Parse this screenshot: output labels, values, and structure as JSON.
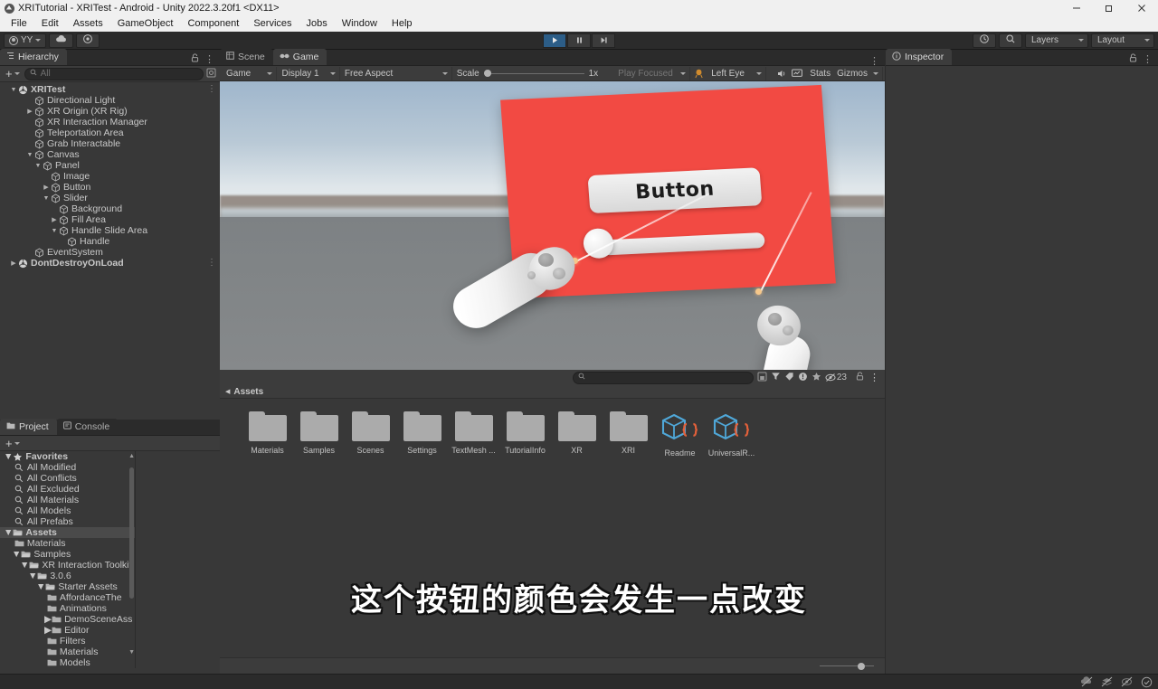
{
  "window": {
    "title": "XRITutorial - XRITest - Android - Unity 2022.3.20f1 <DX11>",
    "app_icon": "unity-logo-icon",
    "minimize": "minimize-icon",
    "restore": "restore-icon",
    "close": "close-icon"
  },
  "menubar": {
    "items": [
      "File",
      "Edit",
      "Assets",
      "GameObject",
      "Component",
      "Services",
      "Jobs",
      "Window",
      "Help"
    ]
  },
  "toolbar": {
    "account_label": "YY",
    "account_icon": "account-icon",
    "cloud_icon": "cloud-icon",
    "settings_icon": "gear-icon",
    "play_icon": "play-icon",
    "pause_icon": "pause-icon",
    "step_icon": "step-icon",
    "play_active": true,
    "history_icon": "undo-history-icon",
    "search_icon": "search-icon",
    "layers_label": "Layers",
    "layout_label": "Layout"
  },
  "hierarchy": {
    "tab_label": "Hierarchy",
    "tab_icon": "hierarchy-icon",
    "lock_icon": "lock-icon",
    "menu_icon": "kebab-icon",
    "add_label": "+",
    "search_placeholder": "All",
    "search_icon": "search-icon",
    "filter_icon": "filter-icon",
    "items": [
      {
        "label": "XRITest",
        "depth": 0,
        "twist": "down",
        "icon": "scene-icon",
        "kebab": true
      },
      {
        "label": "Directional Light",
        "depth": 2,
        "twist": "",
        "icon": "gameobject-icon",
        "kebab": false
      },
      {
        "label": "XR Origin (XR Rig)",
        "depth": 2,
        "twist": "right",
        "icon": "gameobject-icon",
        "kebab": false
      },
      {
        "label": "XR Interaction Manager",
        "depth": 2,
        "twist": "",
        "icon": "gameobject-icon",
        "kebab": false
      },
      {
        "label": "Teleportation Area",
        "depth": 2,
        "twist": "",
        "icon": "gameobject-icon",
        "kebab": false
      },
      {
        "label": "Grab Interactable",
        "depth": 2,
        "twist": "",
        "icon": "gameobject-icon",
        "kebab": false
      },
      {
        "label": "Canvas",
        "depth": 2,
        "twist": "down",
        "icon": "gameobject-icon",
        "kebab": false
      },
      {
        "label": "Panel",
        "depth": 3,
        "twist": "down",
        "icon": "gameobject-icon",
        "kebab": false
      },
      {
        "label": "Image",
        "depth": 4,
        "twist": "",
        "icon": "gameobject-icon",
        "kebab": false
      },
      {
        "label": "Button",
        "depth": 4,
        "twist": "right",
        "icon": "gameobject-icon",
        "kebab": false
      },
      {
        "label": "Slider",
        "depth": 4,
        "twist": "down",
        "icon": "gameobject-icon",
        "kebab": false
      },
      {
        "label": "Background",
        "depth": 5,
        "twist": "",
        "icon": "gameobject-icon",
        "kebab": false
      },
      {
        "label": "Fill Area",
        "depth": 5,
        "twist": "right",
        "icon": "gameobject-icon",
        "kebab": false
      },
      {
        "label": "Handle Slide Area",
        "depth": 5,
        "twist": "down",
        "icon": "gameobject-icon",
        "kebab": false
      },
      {
        "label": "Handle",
        "depth": 6,
        "twist": "",
        "icon": "gameobject-icon",
        "kebab": false
      },
      {
        "label": "EventSystem",
        "depth": 2,
        "twist": "",
        "icon": "gameobject-icon",
        "kebab": false
      },
      {
        "label": "DontDestroyOnLoad",
        "depth": 0,
        "twist": "right",
        "icon": "scene-icon",
        "kebab": true
      }
    ]
  },
  "gameview": {
    "tabs": [
      {
        "label": "Scene",
        "icon": "scene-tab-icon",
        "active": false
      },
      {
        "label": "Game",
        "icon": "game-tab-icon",
        "active": true
      }
    ],
    "menu_icon": "kebab-icon",
    "display_mode": "Game",
    "display": "Display 1",
    "aspect": "Free Aspect",
    "scale_label": "Scale",
    "scale_value": "1x",
    "play_focused": "Play Focused",
    "vr_device_icon": "vr-headset-icon",
    "eye": "Left Eye",
    "mute_icon": "mute-audio-icon",
    "stats_icon": "stats-icon",
    "stats_label": "Stats",
    "gizmos_label": "Gizmos",
    "scene": {
      "button_label": "Button",
      "panel_color": "#f24a43",
      "button_color": "#eeeeee",
      "ray_color": "#ffffff",
      "controller_color": "#ffffff"
    },
    "subtitle": "这个按钮的颜色会发生一点改变"
  },
  "inspector": {
    "tab_label": "Inspector",
    "tab_icon": "info-icon",
    "lock_icon": "lock-icon",
    "menu_icon": "kebab-icon"
  },
  "project": {
    "tabs": [
      {
        "label": "Project",
        "icon": "project-icon",
        "active": true
      },
      {
        "label": "Console",
        "icon": "console-icon",
        "active": false
      }
    ],
    "lock_icon": "lock-icon",
    "menu_icon": "kebab-icon",
    "add_label": "+",
    "search_placeholder": "",
    "search_icon": "search-icon",
    "save_search_icon": "save-search-icon",
    "filter_type_icon": "filter-type-icon",
    "filter_label_icon": "filter-label-icon",
    "warning_filter_icon": "warning-filter-icon",
    "favorite_filter_icon": "star-filter-icon",
    "hidden_packages_icon": "hidden-packages-icon",
    "hidden_packages_count": "23",
    "tree": [
      {
        "label": "Favorites",
        "depth": 0,
        "twist": "down",
        "icon": "star-icon",
        "selected": false
      },
      {
        "label": "All Modified",
        "depth": 1,
        "twist": "",
        "icon": "search-icon",
        "selected": false
      },
      {
        "label": "All Conflicts",
        "depth": 1,
        "twist": "",
        "icon": "search-icon",
        "selected": false
      },
      {
        "label": "All Excluded",
        "depth": 1,
        "twist": "",
        "icon": "search-icon",
        "selected": false
      },
      {
        "label": "All Materials",
        "depth": 1,
        "twist": "",
        "icon": "search-icon",
        "selected": false
      },
      {
        "label": "All Models",
        "depth": 1,
        "twist": "",
        "icon": "search-icon",
        "selected": false
      },
      {
        "label": "All Prefabs",
        "depth": 1,
        "twist": "",
        "icon": "search-icon",
        "selected": false
      },
      {
        "label": "Assets",
        "depth": 0,
        "twist": "down",
        "icon": "folder-open-icon",
        "selected": true
      },
      {
        "label": "Materials",
        "depth": 1,
        "twist": "",
        "icon": "folder-icon",
        "selected": false
      },
      {
        "label": "Samples",
        "depth": 1,
        "twist": "down",
        "icon": "folder-open-icon",
        "selected": false
      },
      {
        "label": "XR Interaction Toolkit",
        "depth": 2,
        "twist": "down",
        "icon": "folder-open-icon",
        "selected": false
      },
      {
        "label": "3.0.6",
        "depth": 3,
        "twist": "down",
        "icon": "folder-open-icon",
        "selected": false
      },
      {
        "label": "Starter Assets",
        "depth": 4,
        "twist": "down",
        "icon": "folder-open-icon",
        "selected": false
      },
      {
        "label": "AffordanceThe",
        "depth": 5,
        "twist": "",
        "icon": "folder-icon",
        "selected": false
      },
      {
        "label": "Animations",
        "depth": 5,
        "twist": "",
        "icon": "folder-icon",
        "selected": false
      },
      {
        "label": "DemoSceneAss",
        "depth": 5,
        "twist": "right",
        "icon": "folder-icon",
        "selected": false
      },
      {
        "label": "Editor",
        "depth": 5,
        "twist": "right",
        "icon": "folder-icon",
        "selected": false
      },
      {
        "label": "Filters",
        "depth": 5,
        "twist": "",
        "icon": "folder-icon",
        "selected": false
      },
      {
        "label": "Materials",
        "depth": 5,
        "twist": "",
        "icon": "folder-icon",
        "selected": false
      },
      {
        "label": "Models",
        "depth": 5,
        "twist": "",
        "icon": "folder-icon",
        "selected": false
      }
    ],
    "breadcrumb": "Assets",
    "assets": [
      {
        "label": "Materials",
        "kind": "folder"
      },
      {
        "label": "Samples",
        "kind": "folder"
      },
      {
        "label": "Scenes",
        "kind": "folder"
      },
      {
        "label": "Settings",
        "kind": "folder"
      },
      {
        "label": "TextMesh ...",
        "kind": "folder"
      },
      {
        "label": "TutorialInfo",
        "kind": "folder"
      },
      {
        "label": "XR",
        "kind": "folder"
      },
      {
        "label": "XRI",
        "kind": "folder"
      },
      {
        "label": "Readme",
        "kind": "scriptable-object"
      },
      {
        "label": "UniversalR...",
        "kind": "scriptable-object"
      }
    ],
    "zoom_value": 70
  },
  "statusbar": {
    "icons": [
      "collab-disabled-icon",
      "layers-disabled-icon",
      "cloud-disabled-icon",
      "check-circle-icon"
    ]
  }
}
